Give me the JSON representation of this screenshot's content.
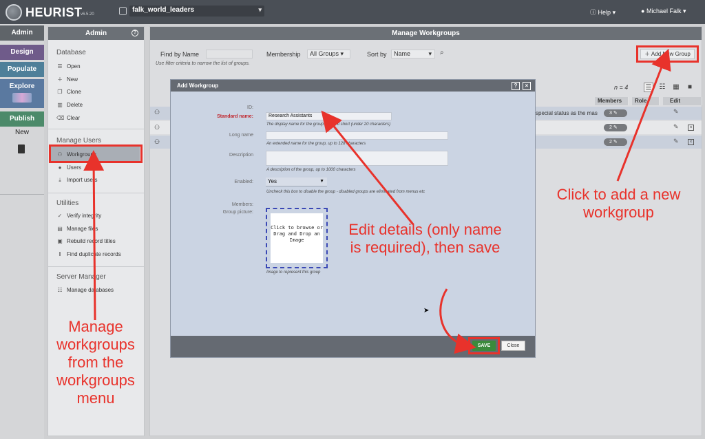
{
  "topbar": {
    "brand": "HEURIST",
    "version": "v6.5.20",
    "database": "falk_world_leaders",
    "help_label": "Help",
    "user_label": "Michael Falk"
  },
  "leftnav": {
    "items": [
      "Admin",
      "Design",
      "Populate",
      "Explore",
      "Publish"
    ],
    "new_label": "New"
  },
  "adminmenu": {
    "title": "Admin",
    "sections": {
      "database": {
        "title": "Database",
        "items": [
          "Open",
          "New",
          "Clone",
          "Delete",
          "Clear"
        ]
      },
      "users": {
        "title": "Manage Users",
        "items": [
          "Workgroups",
          "Users",
          "Import users"
        ]
      },
      "utilities": {
        "title": "Utilities",
        "items": [
          "Verify integrity",
          "Manage files",
          "Rebuild record titles",
          "Find duplicate records"
        ]
      },
      "server": {
        "title": "Server Manager",
        "items": [
          "Manage databases"
        ]
      }
    }
  },
  "main": {
    "title": "Manage Workgroups",
    "filter": {
      "find_label": "Find by Name",
      "membership_label": "Membership",
      "membership_value": "All Groups",
      "sort_label": "Sort by",
      "sort_value": "Name",
      "hint": "Use filter criteria to narrow the list of groups."
    },
    "add_button": "Add New Group",
    "count": "n = 4",
    "columns": [
      "Members",
      "Role",
      "Edit"
    ],
    "rows": [
      {
        "desc": "special status as the mas",
        "members": "3"
      },
      {
        "desc": "",
        "members": "2"
      },
      {
        "desc": "",
        "members": "2"
      }
    ]
  },
  "dialog": {
    "title": "Add Workgroup",
    "id_label": "ID:",
    "name_label": "Standard name:",
    "name_value": "Research Assistants",
    "name_hint": "The display name for the group - keep it short (under 20 characters)",
    "longname_label": "Long name",
    "longname_hint": "An extended name for the group, up to 128 characters",
    "description_label": "Description",
    "description_hint": "A description of the group, up to 1000 characters",
    "enabled_label": "Enabled:",
    "enabled_value": "Yes",
    "enabled_hint": "Uncheck this box to disable the group - disabled groups are eliminated from menus etc",
    "members_label": "Members:",
    "picture_label": "Group picture:",
    "picture_text": "Click to browse or Drag and Drop an Image",
    "picture_hint": "Image to represent this group",
    "save_label": "SAVE",
    "close_label": "Close"
  },
  "annotations": {
    "add_group": "Click to add a new workgroup",
    "edit_details": "Edit details (only name is required), then save",
    "manage_menu": "Manage workgroups from the workgroups menu",
    "color": "#e8322b"
  }
}
